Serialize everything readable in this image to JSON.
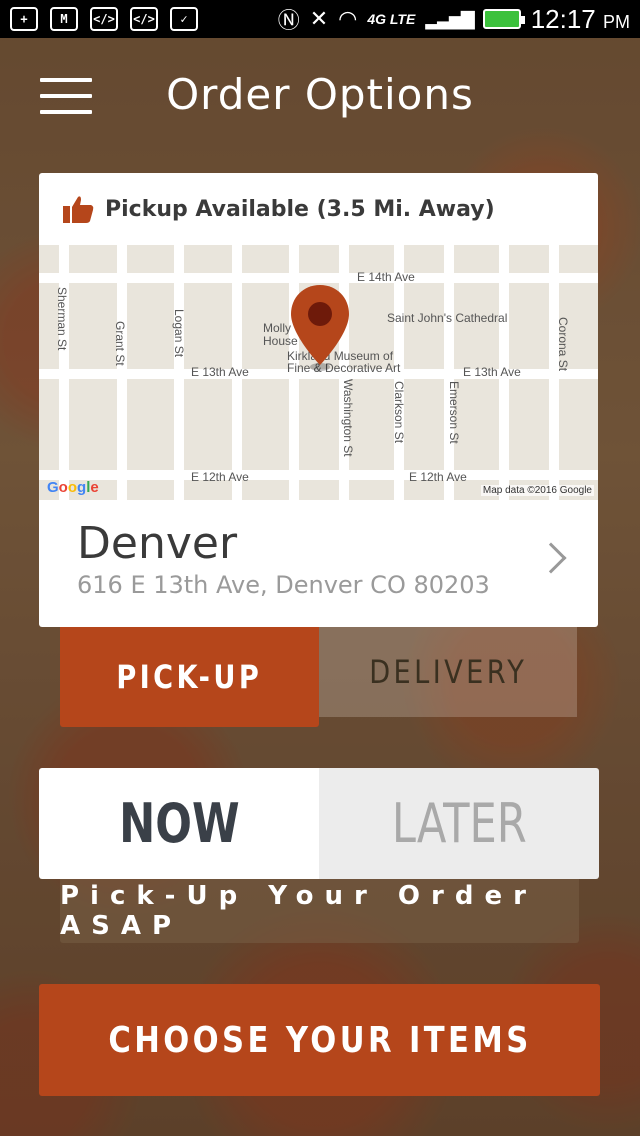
{
  "status_bar": {
    "time": "12:17",
    "ampm": "PM",
    "network": "4G LTE"
  },
  "header": {
    "title": "Order Options"
  },
  "store_card": {
    "availability": "Pickup Available (3.5 Mi. Away)",
    "map": {
      "streets_h": [
        "E 14th Ave",
        "E 13th Ave",
        "E 13th Ave",
        "E 12th Ave",
        "E 12th Ave"
      ],
      "streets_v": [
        "Sherman St",
        "Grant St",
        "Logan St",
        "Washington St",
        "Clarkson St",
        "Emerson St",
        "Corona St"
      ],
      "pois": [
        "Molly",
        "House",
        "Kirkland Museum of",
        "Fine & Decorative Art",
        "Saint John's Cathedral"
      ],
      "logo": "Google",
      "attribution": "Map data ©2016 Google"
    },
    "store_name": "Denver",
    "address": "616 E 13th Ave, Denver CO 80203"
  },
  "order_type": {
    "pickup": "PICK-UP",
    "delivery": "DELIVERY",
    "selected": "pickup"
  },
  "time_option": {
    "now": "NOW",
    "later": "LATER",
    "selected": "now",
    "caption": "Pick-Up Your Order ASAP"
  },
  "cta": {
    "label": "CHOOSE YOUR ITEMS"
  },
  "colors": {
    "accent": "#b5461b",
    "dark_text": "#3a4048"
  }
}
